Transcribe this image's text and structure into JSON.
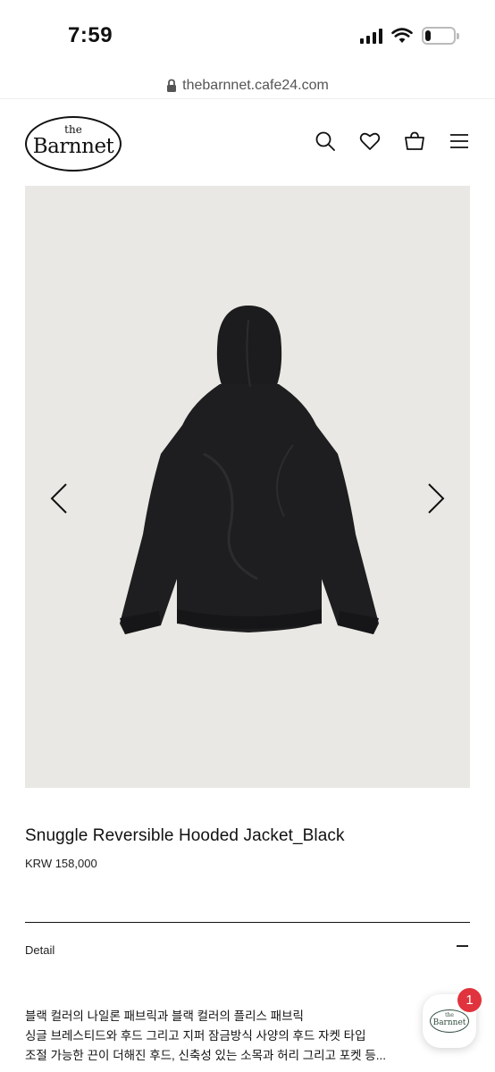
{
  "status_bar": {
    "time": "7:59",
    "battery_level": 0.2
  },
  "browser": {
    "url": "thebarnnet.cafe24.com"
  },
  "header": {
    "logo_small": "the",
    "logo_main": "Barnnet",
    "icons": [
      "search-icon",
      "heart-icon",
      "bag-icon",
      "menu-icon"
    ]
  },
  "product": {
    "image_background": "#e9e8e4",
    "title": "Snuggle Reversible Hooded Jacket_Black",
    "price": "KRW 158,000"
  },
  "detail": {
    "label": "Detail",
    "lines": [
      "블랙 컬러의 나일론 패브릭과 블랙 컬러의 플리스 패브릭",
      "싱글 브레스티드와 후드 그리고 지퍼 잠금방식 사양의 후드 자켓 타입",
      "조절 가능한 끈이 더해진 후드, 신축성 있는 소목과 허리 그리고 포켓 등..."
    ]
  },
  "floating": {
    "logo_small": "the",
    "logo_main": "Barnnet",
    "badge_count": "1",
    "badge_color": "#e0333d"
  }
}
